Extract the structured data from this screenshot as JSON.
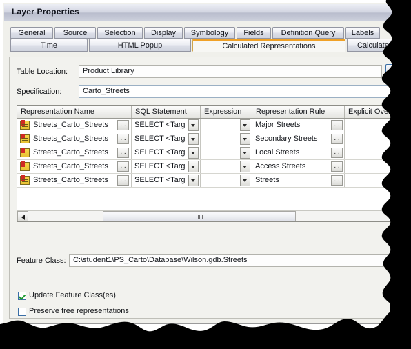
{
  "window": {
    "title": "Layer Properties"
  },
  "tabs": {
    "row1": [
      {
        "label": "General",
        "active": false
      },
      {
        "label": "Source",
        "active": false
      },
      {
        "label": "Selection",
        "active": false
      },
      {
        "label": "Display",
        "active": false
      },
      {
        "label": "Symbology",
        "active": false
      },
      {
        "label": "Fields",
        "active": false
      },
      {
        "label": "Definition Query",
        "active": false
      },
      {
        "label": "Labels",
        "active": false
      }
    ],
    "row2": [
      {
        "label": "Time",
        "active": false
      },
      {
        "label": "HTML Popup",
        "active": false
      },
      {
        "label": "Calculated Representations",
        "active": true
      },
      {
        "label": "Calculated",
        "active": false
      }
    ]
  },
  "form": {
    "table_location_label": "Table Location:",
    "table_location_value": "Product Library",
    "specification_label": "Specification:",
    "specification_value": "Carto_Streets",
    "browse_button_label": ""
  },
  "grid": {
    "columns": [
      "Representation Name",
      "SQL Statement",
      "Expression",
      "Representation Rule",
      "Explicit Override"
    ],
    "ellipsis_label": "...",
    "rows": [
      {
        "name": "Streets_Carto_Streets",
        "sql": "SELECT <Targ",
        "expression": "",
        "rule": "Major Streets",
        "override": ""
      },
      {
        "name": "Streets_Carto_Streets",
        "sql": "SELECT <Targ",
        "expression": "",
        "rule": "Secondary Streets",
        "override": ""
      },
      {
        "name": "Streets_Carto_Streets",
        "sql": "SELECT <Targ",
        "expression": "",
        "rule": "Local Streets",
        "override": ""
      },
      {
        "name": "Streets_Carto_Streets",
        "sql": "SELECT <Targ",
        "expression": "",
        "rule": "Access Streets",
        "override": ""
      },
      {
        "name": "Streets_Carto_Streets",
        "sql": "SELECT <Targ",
        "expression": "",
        "rule": "Streets",
        "override": ""
      }
    ]
  },
  "footer": {
    "feature_class_label": "Feature Class:",
    "feature_class_value": "C:\\student1\\PS_Carto\\Database\\Wilson.gdb.Streets",
    "checkbox_update": "Update Feature Class(es)",
    "checkbox_update_checked": true,
    "checkbox_preserve": "Preserve free representations",
    "checkbox_preserve_checked": false
  },
  "colors": {
    "accent_tab": "#f0a126",
    "panel_bg": "#f2f2ee",
    "titlebar": "#ccd0dc",
    "check_green": "#1d9a2f",
    "field_border": "#9bb0c4"
  }
}
